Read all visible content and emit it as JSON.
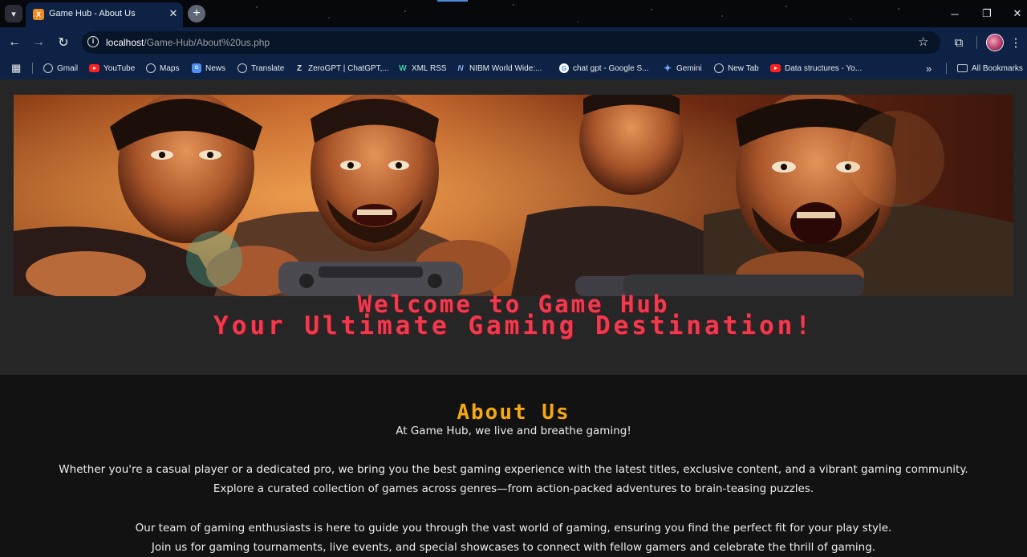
{
  "browser": {
    "tab_title": "Game Hub - About Us",
    "tab_favicon_letter": "X",
    "url_host": "localhost",
    "url_path": "/Game-Hub/About%20us.php",
    "bookmarks": [
      {
        "label": "Gmail",
        "icon": "globe-icon"
      },
      {
        "label": "YouTube",
        "icon": "youtube-icon"
      },
      {
        "label": "Maps",
        "icon": "globe-icon"
      },
      {
        "label": "News",
        "icon": "news-icon"
      },
      {
        "label": "Translate",
        "icon": "globe-icon"
      },
      {
        "label": "ZeroGPT | ChatGPT,...",
        "icon": "zerogpt-icon"
      },
      {
        "label": "XML RSS",
        "icon": "wp-icon"
      },
      {
        "label": "NIBM World Wide:...",
        "icon": "nibm-icon"
      },
      {
        "label": "chat gpt - Google S...",
        "icon": "google-icon"
      },
      {
        "label": "Gemini",
        "icon": "gemini-icon"
      },
      {
        "label": "New Tab",
        "icon": "globe-icon"
      },
      {
        "label": "Data structures - Yo...",
        "icon": "youtube-icon"
      }
    ],
    "all_bookmarks_label": "All Bookmarks",
    "more_bookmarks_label": "»"
  },
  "page": {
    "welcome_line1": "Welcome to Game Hub",
    "welcome_line2": "Your Ultimate Gaming Destination!",
    "about_title": "About Us",
    "about_intro": "At Game Hub, we live and breathe gaming!",
    "paragraph1_line1": "Whether you're a casual player or a dedicated pro, we bring you the best gaming experience with the latest titles, exclusive content, and a vibrant gaming community.",
    "paragraph1_line2": "Explore a curated collection of games across genres—from action-packed adventures to brain-teasing puzzles.",
    "paragraph2_line1": "Our team of gaming enthusiasts is here to guide you through the vast world of gaming, ensuring you find the perfect fit for your play style.",
    "paragraph2_line2": "Join us for gaming tournaments, live events, and special showcases to connect with fellow gamers and celebrate the thrill of gaming."
  },
  "colors": {
    "browser_chrome": "#0d2244",
    "page_bg": "#121212",
    "hero_bg": "#262626",
    "welcome_red": "#f23a4f",
    "about_gold": "#f5a80f"
  }
}
